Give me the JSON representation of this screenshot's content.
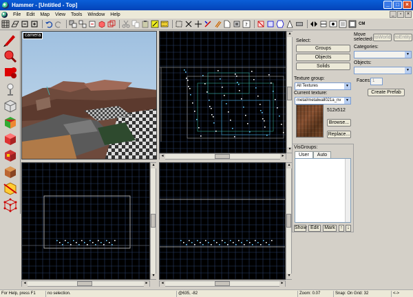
{
  "window": {
    "title": "Hammer - [Untitled - Top]"
  },
  "menu": {
    "items": [
      "File",
      "Edit",
      "Map",
      "View",
      "Tools",
      "Window",
      "Help"
    ]
  },
  "toolbar": {
    "cm_label": "CM"
  },
  "viewports": {
    "camera_label": "camera"
  },
  "select": {
    "label": "Select:",
    "groups": "Groups",
    "objects": "Objects",
    "solids": "Solids"
  },
  "texture": {
    "group_label": "Texture group:",
    "group_value": "All Textures",
    "current_label": "Current texture:",
    "current_value": "metal/metalwall021a_nv",
    "size": "512x512",
    "browse": "Browse...",
    "replace": "Replace..."
  },
  "visgroups": {
    "label": "VisGroups:",
    "tabs": [
      "User",
      "Auto"
    ],
    "show": "Show",
    "edit": "Edit",
    "mark": "Mark"
  },
  "move": {
    "label": "Move selected:",
    "to_world": "toWorld",
    "to_entity": "toEntity",
    "categories_label": "Categories:",
    "objects_label": "Objects:",
    "faces_label": "Faces:",
    "faces_value": "1",
    "create_prefab": "Create Prefab"
  },
  "status": {
    "help": "For Help, press F1",
    "selection": "no selection.",
    "coords": "@635, -82",
    "zoom": "Zoom: 0.07",
    "snap": "Snap: On Grid: 32",
    "end": "<->"
  }
}
